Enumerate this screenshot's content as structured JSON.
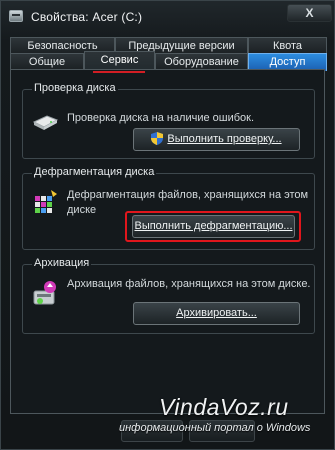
{
  "window": {
    "title": "Свойства: Acer (C:)",
    "close_glyph": "X"
  },
  "tabs_row1": [
    "Безопасность",
    "Предыдущие версии",
    "Квота"
  ],
  "tabs_row2": [
    "Общие",
    "Сервис",
    "Оборудование",
    "Доступ"
  ],
  "groups": [
    {
      "title": "Проверка диска",
      "description": "Проверка диска на наличие ошибок.",
      "button": "Выполнить проверку...",
      "icon": "disk-drive-icon"
    },
    {
      "title": "Дефрагментация диска",
      "description_line1": "Дефрагментация файлов, хранящихся на этом",
      "description_line2": "диске",
      "button": "Выполнить дефрагментацию...",
      "icon": "defrag-icon"
    },
    {
      "title": "Архивация",
      "description": "Архивация файлов, хранящихся на этом диске.",
      "button": "Архивировать...",
      "icon": "backup-icon"
    }
  ],
  "watermark": {
    "title": "VindaVoz.ru",
    "subtitle": "информационный портал о Windows"
  },
  "colors": {
    "highlight": "#e0161c",
    "selected_tab": "#1b5fb0",
    "background": "#14191c"
  }
}
